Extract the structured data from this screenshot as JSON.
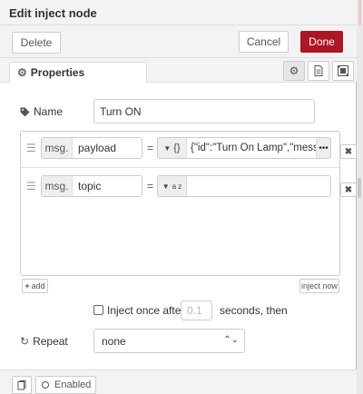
{
  "window": {
    "title": "Edit inject node"
  },
  "toolbar": {
    "delete_label": "Delete",
    "cancel_label": "Cancel",
    "done_label": "Done"
  },
  "tabs": {
    "properties_label": "Properties",
    "icons": [
      "gear-icon",
      "document-icon",
      "layout-icon"
    ]
  },
  "form": {
    "name_label": "Name",
    "name_value": "Turn ON",
    "properties": [
      {
        "prefix": "msg.",
        "property": "payload",
        "equals": "=",
        "type_icon": "{}",
        "value": "{\"id\":\"Turn On Lamp\",\"messa",
        "more": "•••"
      },
      {
        "prefix": "msg.",
        "property": "topic",
        "equals": "=",
        "type_icon": "a z",
        "value": ""
      }
    ],
    "add_label": "add",
    "inject_now_label": "inject now",
    "inject_once_label": "Inject once after",
    "inject_delay_placeholder": "0.1",
    "seconds_then_label": "seconds, then",
    "repeat_label": "Repeat",
    "repeat_value": "none"
  },
  "footer": {
    "enabled_label": "Enabled"
  },
  "colors": {
    "primary": "#ad1625",
    "border": "#cccccc",
    "panel": "#f3f3f3"
  }
}
